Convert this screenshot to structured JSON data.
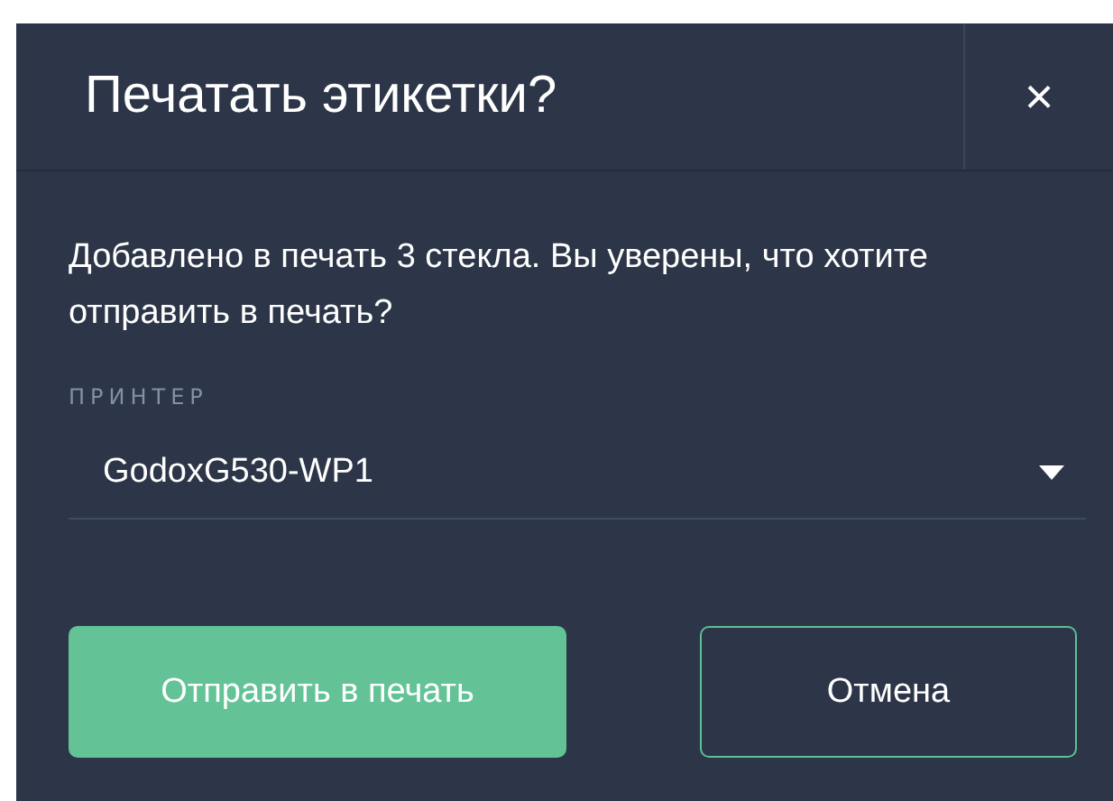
{
  "dialog": {
    "title": "Печатать этикетки?",
    "close": "×"
  },
  "message": "Добавлено в печать 3 стекла. Вы уверены, что хотите отправить в печать?",
  "printer": {
    "label": "ПРИНТЕР",
    "value": "GodoxG530-WP1"
  },
  "buttons": [
    {
      "label": "Отправить в печать",
      "kind": "primary"
    },
    {
      "label": "Отмена",
      "kind": "secondary"
    }
  ]
}
